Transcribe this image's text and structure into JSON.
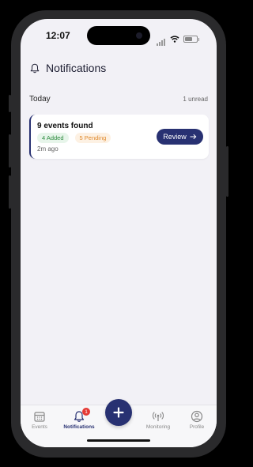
{
  "status_bar": {
    "time": "12:07"
  },
  "header": {
    "title": "Notifications",
    "icon": "bell-icon"
  },
  "section": {
    "title": "Today",
    "unread": "1 unread"
  },
  "notification": {
    "title": "9 events found",
    "badges": [
      {
        "label": "4 Added",
        "color": "#2e8b3f"
      },
      {
        "label": "5 Pending",
        "color": "#e08a2e"
      }
    ],
    "time": "2m ago",
    "action_label": "Review",
    "action_icon": "arrow-right-icon"
  },
  "tabbar": {
    "tabs": [
      {
        "label": "Events",
        "icon": "calendar-icon"
      },
      {
        "label": "Notifications",
        "icon": "bell-icon",
        "badge": "1",
        "active": true
      },
      {
        "label": "Monitoring",
        "icon": "broadcast-icon"
      },
      {
        "label": "Profile",
        "icon": "user-icon"
      }
    ],
    "fab_icon": "plus-icon"
  },
  "colors": {
    "primary": "#283172",
    "background": "#f2f1f6",
    "badge_red": "#e53935"
  }
}
